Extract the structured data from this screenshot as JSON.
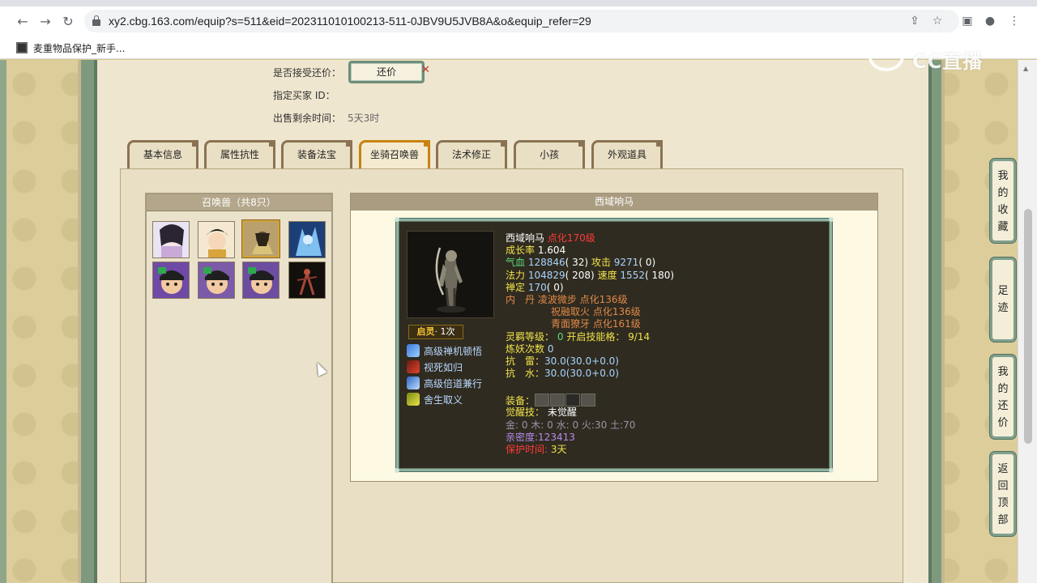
{
  "browser": {
    "url": "xy2.cbg.163.com/equip?s=511&eid=202311010100213-511-0JBV9U5JVB8A&o&equip_refer=29",
    "bookmark": "麦重物品保护_新手...",
    "back_icon": "←",
    "forward_icon": "→",
    "reload_icon": "↻",
    "share_icon": "⇪",
    "star_icon": "☆",
    "panel_icon": "▣",
    "profile_icon": "●",
    "menu_icon": "⋮"
  },
  "watermark": {
    "text": "CC直播"
  },
  "trade_info": {
    "accept_counter_label": "是否接受还价：",
    "counter_button": "还价",
    "counter_close": "✕",
    "buyer_id_label": "指定买家 ID：",
    "time_left_label": "出售剩余时间：",
    "time_left_value": "5天3时"
  },
  "tabs": [
    {
      "label": "基本信息"
    },
    {
      "label": "属性抗性"
    },
    {
      "label": "装备法宝"
    },
    {
      "label": "坐骑召唤兽",
      "active": true
    },
    {
      "label": "法术修正"
    },
    {
      "label": "小孩"
    },
    {
      "label": "外观道具"
    }
  ],
  "pet_list": {
    "title": "召唤兽（共8只）",
    "selected_index": 2
  },
  "pet_detail": {
    "header": "西域响马",
    "name": "西域响马",
    "level_text": "点化170级",
    "growth_label": "成长率",
    "growth_value": "1.604",
    "hp_label": "气血",
    "hp_value": "128846",
    "hp_extra": "( 32)",
    "atk_label": "攻击",
    "atk_value": "9271",
    "atk_extra": "( 0)",
    "mp_label": "法力",
    "mp_value": "104829",
    "mp_extra": "( 208)",
    "spd_label": "速度",
    "spd_value": "1552",
    "spd_extra": "( 180)",
    "cal_label": "禅定",
    "cal_value": "170",
    "cal_extra": "( 0)",
    "dan_label": "内　丹",
    "dan": [
      "凌波微步 点化136级",
      "祝融取火 点化136级",
      "青面獠牙 点化161级"
    ],
    "spirit_label": "灵羁等级：",
    "spirit_value": "0",
    "slot_label": "开启技能格：",
    "slot_value": "9/14",
    "refine_label": "炼妖次数",
    "refine_value": "0",
    "resist1_label": "抗　雷：",
    "resist1_value": "30.0(30.0+0.0)",
    "resist2_label": "抗　水：",
    "resist2_value": "30.0(30.0+0.0)",
    "equip_label": "装备：",
    "awaken_label": "觉醒技：",
    "awaken_value": "未觉醒",
    "elements": "金: 0 木: 0 水: 0 火:30 土:70",
    "intimacy": "亲密度:123413",
    "protect_label": "保护时间:",
    "protect_value": "3天",
    "badge_label": "启灵",
    "badge_count": "· 1次",
    "skills": [
      "高级禅机顿悟",
      "视死如归",
      "高级倍道兼行",
      "舍生取义"
    ]
  },
  "side_menu": [
    {
      "label": [
        "我",
        "的",
        "收",
        "藏"
      ]
    },
    {
      "label": [
        "足",
        "迹"
      ]
    },
    {
      "label": [
        "我",
        "的",
        "还",
        "价"
      ]
    },
    {
      "label": [
        "返",
        "回",
        "顶",
        "部"
      ]
    }
  ]
}
